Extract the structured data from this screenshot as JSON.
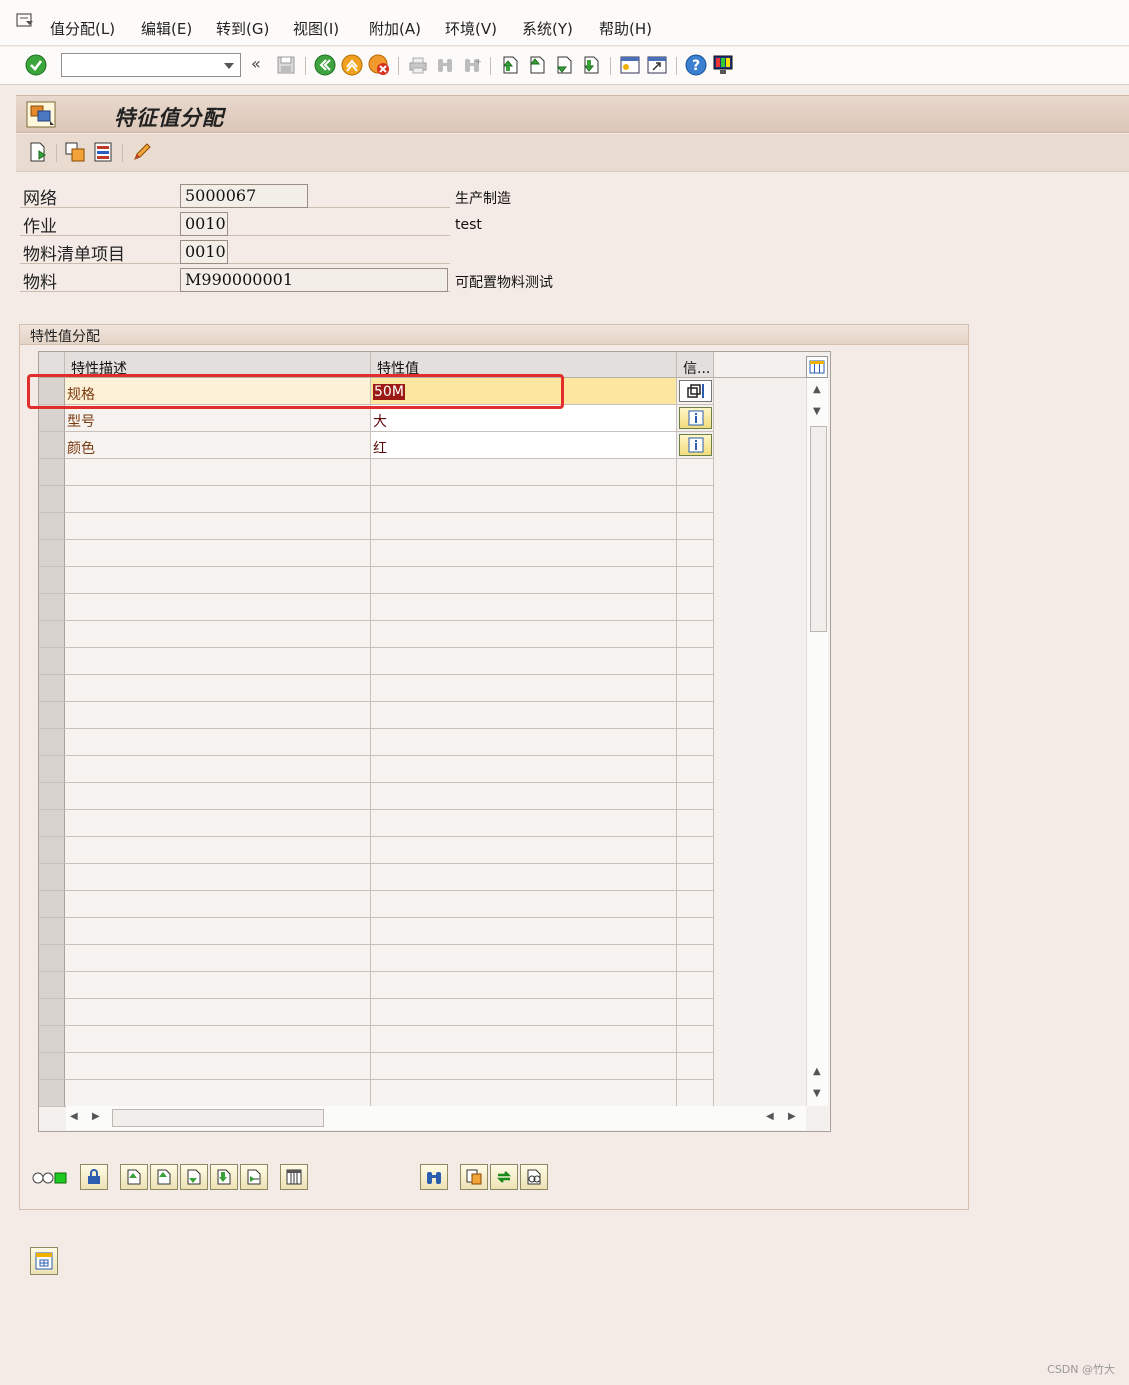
{
  "menu": {
    "items": [
      "值分配(L)",
      "编辑(E)",
      "转到(G)",
      "视图(I)",
      "附加(A)",
      "环境(V)",
      "系统(Y)",
      "帮助(H)"
    ]
  },
  "toolbar": {
    "command_field_value": "",
    "icons": [
      "enter-icon",
      "back-icon",
      "exit-icon",
      "cancel-icon",
      "print-icon",
      "find-icon",
      "find-next-icon",
      "first-page-icon",
      "prev-page-icon",
      "next-page-icon",
      "last-page-icon",
      "new-session-icon",
      "shortcut-icon",
      "help-icon",
      "layout-icon"
    ]
  },
  "title": {
    "text": "特征值分配"
  },
  "header": {
    "network_label": "网络",
    "network_value": "5000067",
    "network_desc": "生产制造",
    "activity_label": "作业",
    "activity_value": "0010",
    "activity_desc": "test",
    "bom_label": "物料清单项目",
    "bom_value": "0010",
    "material_label": "物料",
    "material_value": "M990000001",
    "material_desc": "可配置物料测试"
  },
  "group": {
    "title": "特性值分配"
  },
  "table": {
    "columns": [
      "特性描述",
      "特性值",
      "信..."
    ],
    "rows": [
      {
        "desc": "规格",
        "value": "50M"
      },
      {
        "desc": "型号",
        "value": "大"
      },
      {
        "desc": "颜色",
        "value": "红"
      }
    ]
  },
  "colors": {
    "highlight": "#e22d2d",
    "selected_value_bg": "#9b1b14",
    "desc_text": "#7a3b10"
  },
  "watermark": "CSDN @竹大"
}
